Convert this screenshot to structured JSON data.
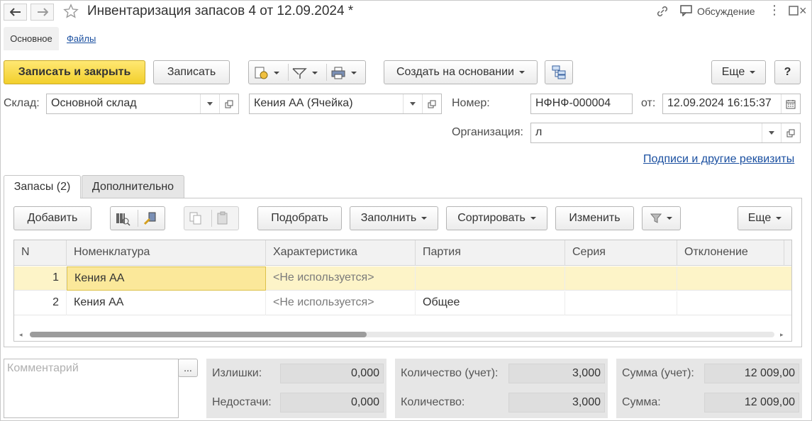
{
  "window": {
    "title": "Инвентаризация запасов 4 от 12.09.2024 *",
    "discussion_label": "Обсуждение"
  },
  "section_tabs": [
    {
      "label": "Основное",
      "active": true
    },
    {
      "label": "Файлы",
      "active": false
    }
  ],
  "toolbar": {
    "save_close": "Записать и закрыть",
    "save": "Записать",
    "create_based": "Создать на основании",
    "more": "Еще",
    "help": "?"
  },
  "form": {
    "warehouse_label": "Склад:",
    "warehouse_value": "Основной склад",
    "cell_value": "Кения АА (Ячейка)",
    "number_label": "Номер:",
    "number_value": "НФНФ-000004",
    "date_label": "от:",
    "date_value": "12.09.2024 16:15:37",
    "org_label": "Организация:",
    "org_value": "л",
    "signatures_link": "Подписи и другие реквизиты"
  },
  "inner_tabs": [
    {
      "label": "Запасы (2)",
      "active": true
    },
    {
      "label": "Дополнительно",
      "active": false
    }
  ],
  "table_toolbar": {
    "add": "Добавить",
    "pick": "Подобрать",
    "fill": "Заполнить",
    "sort": "Сортировать",
    "change": "Изменить",
    "more": "Еще"
  },
  "table": {
    "columns": [
      "N",
      "Номенклатура",
      "Характеристика",
      "Партия",
      "Серия",
      "Отклонение"
    ],
    "rows": [
      {
        "n": "1",
        "nomenclature": "Кения АА",
        "characteristic": "<Не используется>",
        "batch": "",
        "series": "",
        "deviation": ""
      },
      {
        "n": "2",
        "nomenclature": "Кения АА",
        "characteristic": "<Не используется>",
        "batch": "Общее",
        "series": "",
        "deviation": ""
      }
    ]
  },
  "footer": {
    "comment_placeholder": "Комментарий",
    "comment_button": "...",
    "surplus_label": "Излишки:",
    "surplus_value": "0,000",
    "shortage_label": "Недостачи:",
    "shortage_value": "0,000",
    "qty_account_label": "Количество (учет):",
    "qty_account_value": "3,000",
    "qty_label": "Количество:",
    "qty_value": "3,000",
    "sum_account_label": "Сумма (учет):",
    "sum_account_value": "12 009,00",
    "sum_label": "Сумма:",
    "sum_value": "12 009,00"
  },
  "colors": {
    "accent_yellow": "#f2cf2c",
    "selected_row": "#fdf4c8",
    "link_blue": "#1a4fa0"
  }
}
